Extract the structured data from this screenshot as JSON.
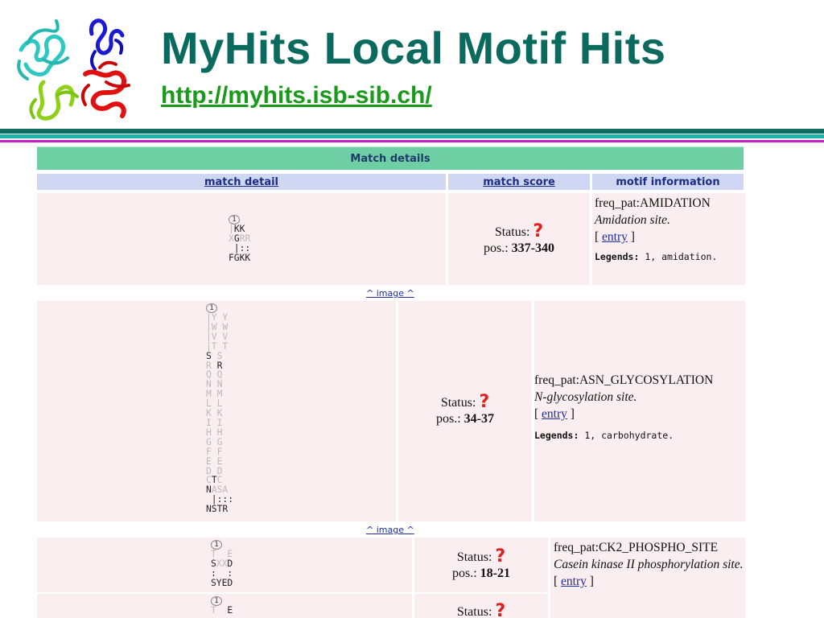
{
  "slide": {
    "title": "MyHits Local Motif Hits",
    "url": "http://myhits.isb-sib.ch/"
  },
  "colors": {
    "title": "#0b6a5e",
    "url": "#1a9a1a",
    "caption_bg": "#6fcfa4",
    "header_bg": "#cfd7f2",
    "row_bg": "#fbeef1",
    "status_icon": "#e0201a"
  },
  "table": {
    "caption": "Match details",
    "headers": {
      "match_detail": "match detail",
      "match_score": "match score",
      "motif_information": "motif information"
    },
    "image_link": "^ image ^",
    "rows": [
      {
        "num": "1",
        "status_label": "Status:",
        "status_icon": "?",
        "pos_label": "pos.:",
        "pos": "337-340",
        "motif": "freq_pat:AMIDATION",
        "description": "Amidation site.",
        "entry": "entry",
        "legends_label": "Legends:",
        "legends": "1, amidation."
      },
      {
        "num": "1",
        "status_label": "Status:",
        "status_icon": "?",
        "pos_label": "pos.:",
        "pos": "34-37",
        "motif": "freq_pat:ASN_GLYCOSYLATION",
        "description": "N-glycosylation site.",
        "entry": "entry",
        "legends_label": "Legends:",
        "legends": "1, carbohydrate."
      },
      {
        "num": "1",
        "status_label": "Status:",
        "status_icon": "?",
        "pos_label": "pos.:",
        "pos": "18-21",
        "motif": "freq_pat:CK2_PHOSPHO_SITE",
        "description": "Casein kinase II phosphorylation site.",
        "entry": "entry"
      },
      {
        "num": "1",
        "status_label": "Status:",
        "status_icon": "?"
      }
    ]
  }
}
